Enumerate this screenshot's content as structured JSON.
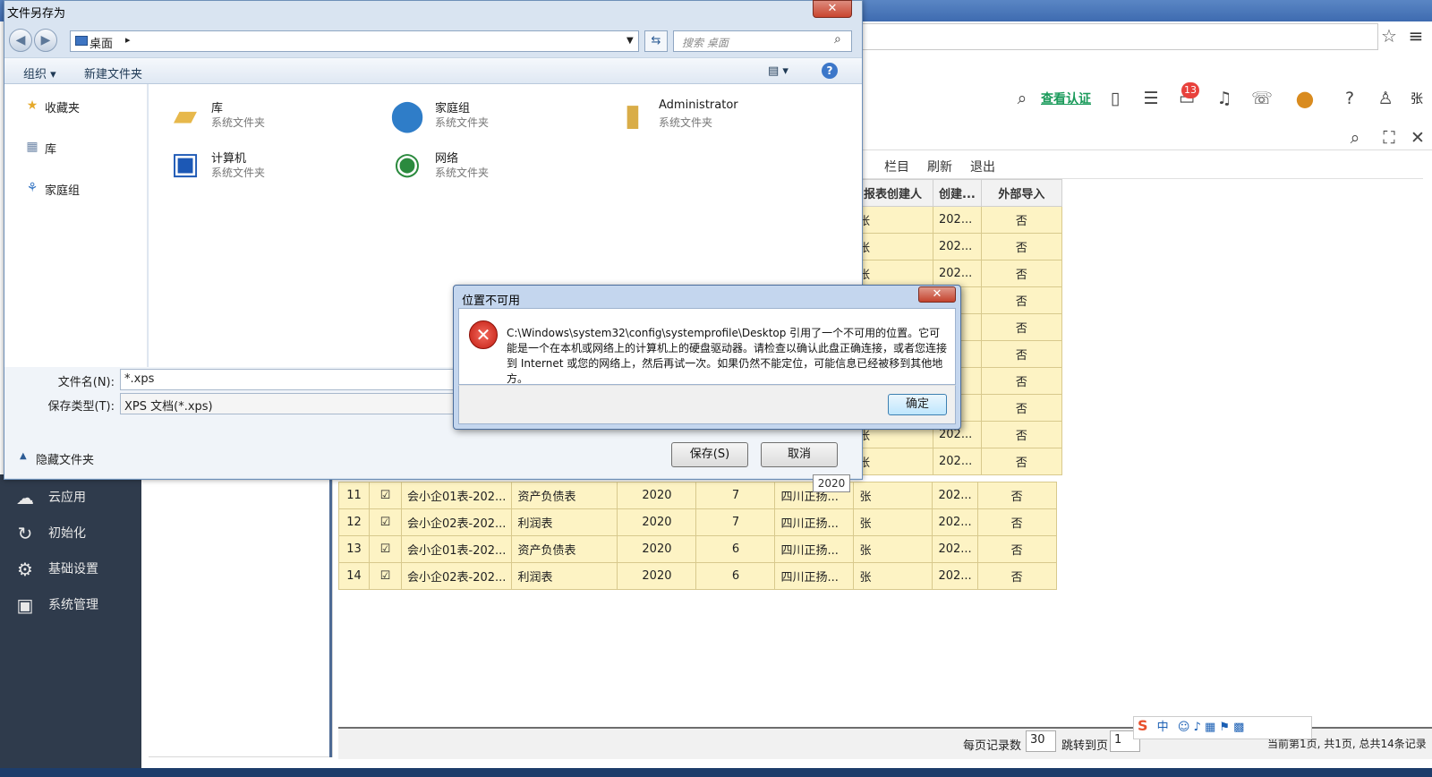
{
  "save_dialog": {
    "title": "文件另存为",
    "close": "✕",
    "path": "桌面",
    "search_placeholder": "搜索 桌面",
    "organize": "组织 ▾",
    "new_folder": "新建文件夹",
    "nav": [
      "收藏夹",
      "库",
      "家庭组"
    ],
    "items": [
      {
        "name": "库",
        "type": "系统文件夹"
      },
      {
        "name": "家庭组",
        "type": "系统文件夹"
      },
      {
        "name": "Administrator",
        "type": "系统文件夹"
      },
      {
        "name": "计算机",
        "type": "系统文件夹"
      },
      {
        "name": "网络",
        "type": "系统文件夹"
      }
    ],
    "filename_label": "文件名(N):",
    "filename_value": "*.xps",
    "filetype_label": "保存类型(T):",
    "filetype_value": "XPS 文档(*.xps)",
    "hide_folders": "隐藏文件夹",
    "save_button": "保存(S)",
    "cancel_button": "取消",
    "tooltip": "2020"
  },
  "error_dialog": {
    "title": "位置不可用",
    "close": "✕",
    "message": "C:\\Windows\\system32\\config\\systemprofile\\Desktop 引用了一个不可用的位置。它可能是一个在本机或网络上的计算机上的硬盘驱动器。请检查以确认此盘正确连接，或者您连接到 Internet 或您的网络上，然后再试一次。如果仍然不能定位，可能信息已经被移到其他地方。",
    "ok_button": "确定"
  },
  "app": {
    "certify_link": "查看认证",
    "notification_count": "13",
    "user_short": "张",
    "toolbar": {
      "columns": "栏目",
      "refresh": "刷新",
      "exit": "退出"
    },
    "sidebar": [
      "云应用",
      "初始化",
      "基础设置",
      "系统管理"
    ],
    "right_grid": {
      "headers": [
        "报表创建人",
        "创建...",
        "外部导入"
      ],
      "rows": [
        [
          "张",
          "202...",
          "否"
        ],
        [
          "张",
          "202...",
          "否"
        ],
        [
          "张",
          "202...",
          "否"
        ],
        [
          "",
          "...",
          "否"
        ],
        [
          "",
          "...",
          "否"
        ],
        [
          "",
          "...",
          "否"
        ],
        [
          "",
          "...",
          "否"
        ],
        [
          "",
          "...",
          "否"
        ],
        [
          "张",
          "202...",
          "否"
        ],
        [
          "张",
          "202...",
          "否"
        ]
      ]
    },
    "main_grid": [
      [
        "11",
        "会小企01表-202...",
        "资产负债表",
        "2020",
        "7",
        "四川正扬...",
        "张",
        "202...",
        "否"
      ],
      [
        "12",
        "会小企02表-202...",
        "利润表",
        "2020",
        "7",
        "四川正扬...",
        "张",
        "202...",
        "否"
      ],
      [
        "13",
        "会小企01表-202...",
        "资产负债表",
        "2020",
        "6",
        "四川正扬...",
        "张",
        "202...",
        "否"
      ],
      [
        "14",
        "会小企02表-202...",
        "利润表",
        "2020",
        "6",
        "四川正扬...",
        "张",
        "202...",
        "否"
      ]
    ],
    "pager": {
      "per_page_label": "每页记录数",
      "per_page_value": "30",
      "jump_label": "跳转到页",
      "jump_value": "1",
      "summary": "当前第1页, 共1页, 总共14条记录"
    }
  }
}
